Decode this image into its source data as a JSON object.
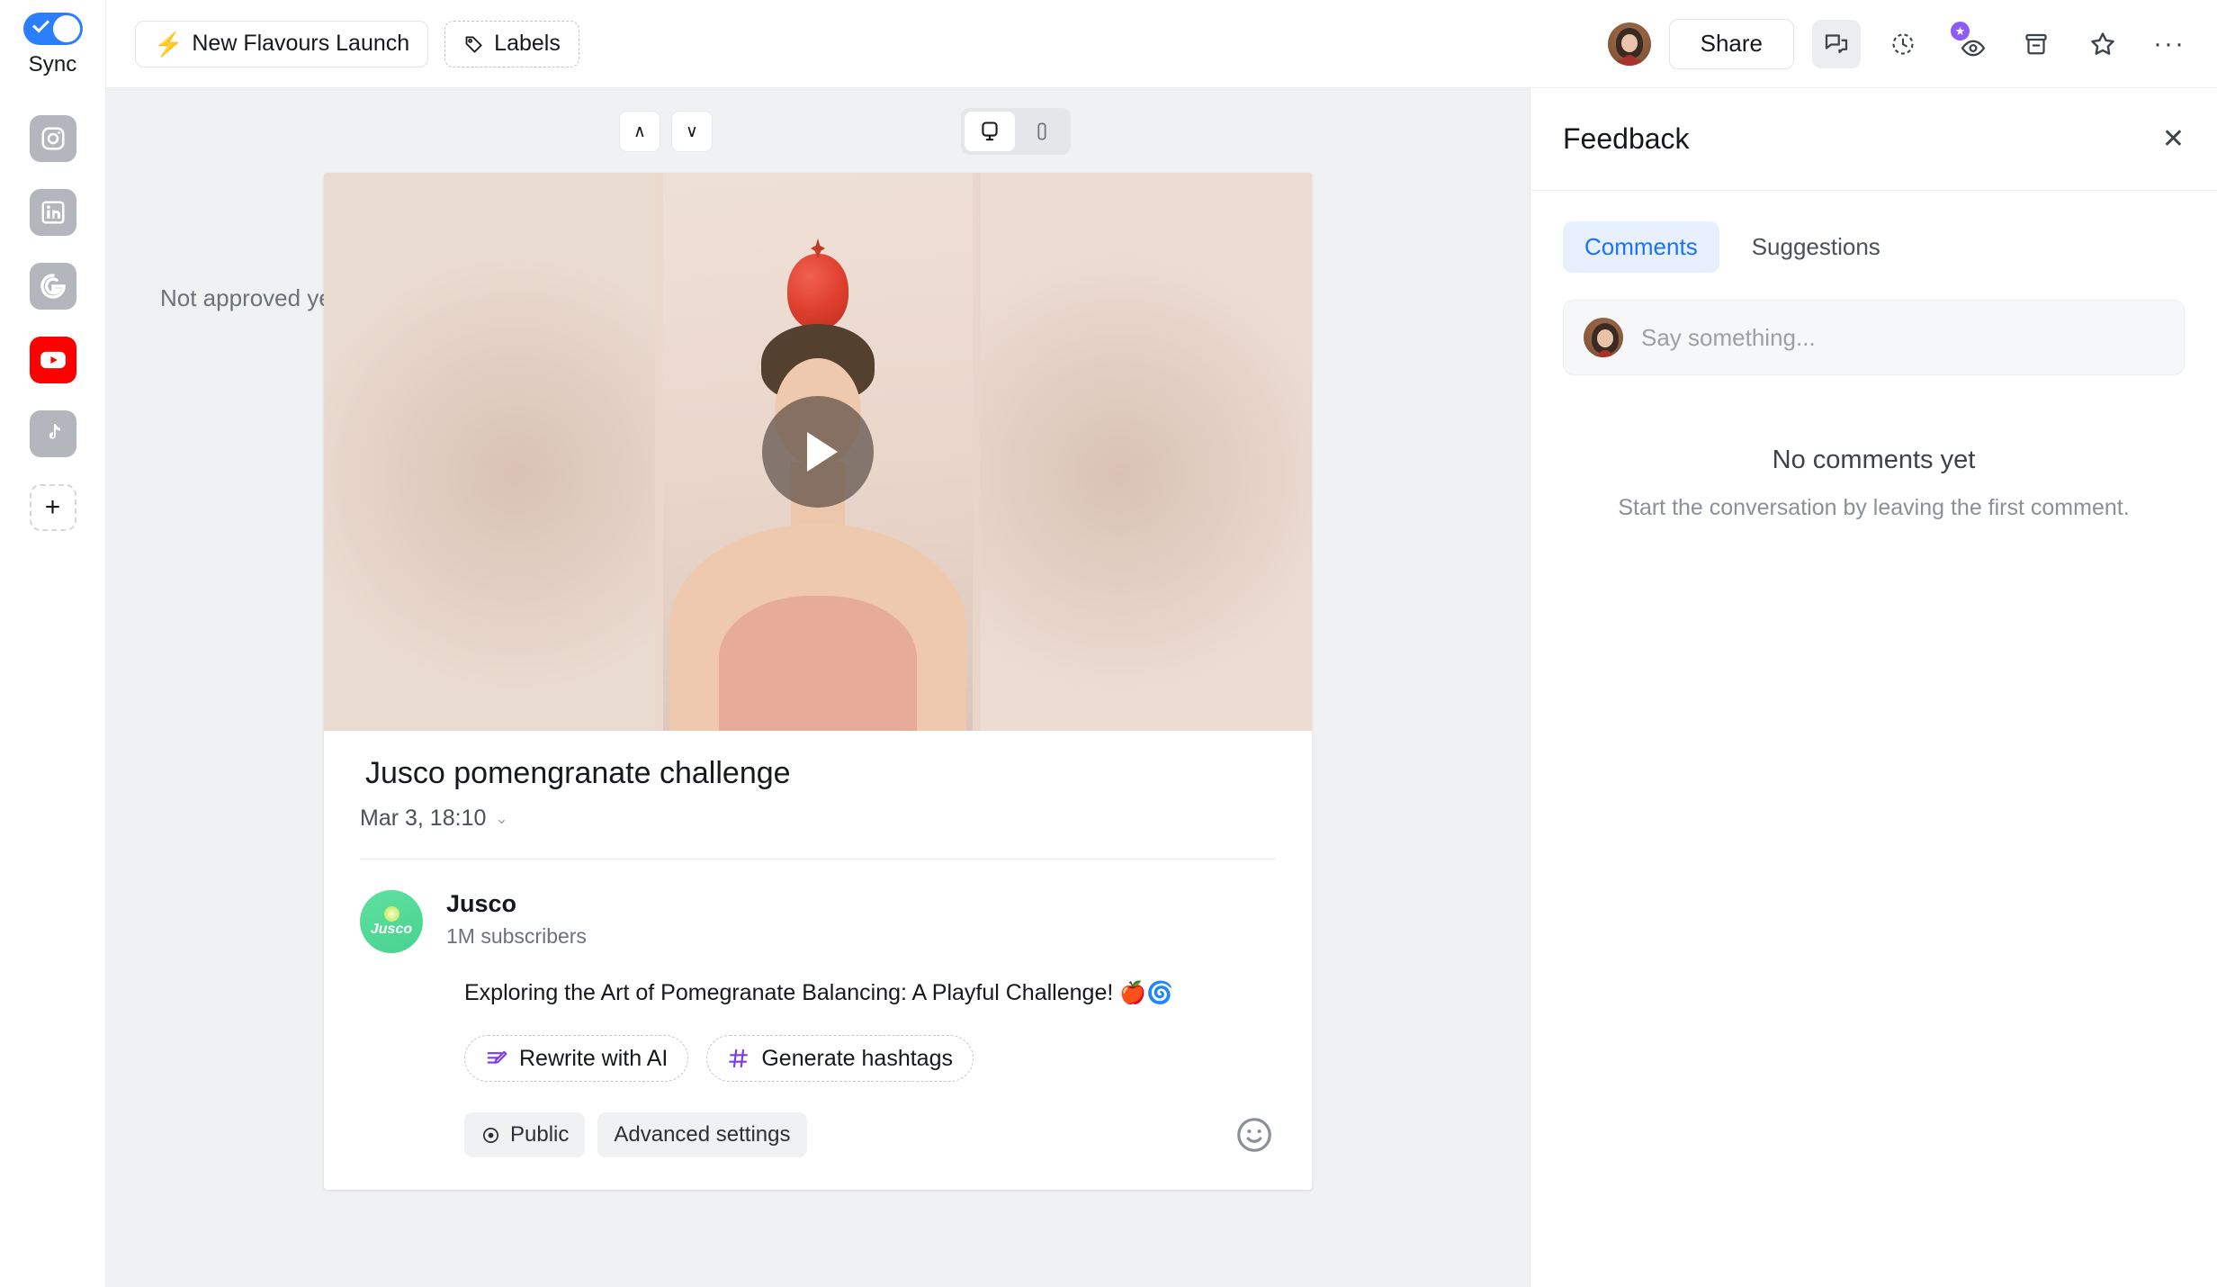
{
  "rail": {
    "sync": {
      "label": "Sync",
      "enabled": true
    },
    "channels": [
      {
        "name": "instagram",
        "icon": "instagram-icon",
        "active": false
      },
      {
        "name": "linkedin",
        "icon": "linkedin-icon",
        "active": false
      },
      {
        "name": "google",
        "icon": "google-icon",
        "active": false
      },
      {
        "name": "youtube",
        "icon": "youtube-icon",
        "active": true
      },
      {
        "name": "tiktok",
        "icon": "tiktok-icon",
        "active": false
      }
    ],
    "add_label": "+"
  },
  "topbar": {
    "campaign": {
      "label": "New Flavours Launch",
      "icon": "lightning-icon"
    },
    "labels": {
      "label": "Labels",
      "icon": "tag-icon"
    },
    "share_label": "Share",
    "icons": [
      {
        "name": "comments-icon",
        "active": true
      },
      {
        "name": "history-clock-icon",
        "active": false
      },
      {
        "name": "preview-eye-icon",
        "active": false,
        "badge": "star"
      },
      {
        "name": "archive-icon",
        "active": false
      },
      {
        "name": "star-icon",
        "active": false
      },
      {
        "name": "more-options-icon",
        "active": false
      }
    ]
  },
  "canvas": {
    "approval_status": "Not approved yet",
    "nav": {
      "up": "∧",
      "down": "∨"
    },
    "device_toggle": {
      "desktop_active": true,
      "mobile_active": false
    }
  },
  "post": {
    "title": "Jusco pomengranate challenge",
    "date": "Mar 3, 18:10",
    "channel": {
      "name": "Jusco",
      "subscribers": "1M subscribers",
      "avatar_text": "Jusco"
    },
    "description": "Exploring the Art of Pomegranate Balancing: A Playful Challenge!",
    "description_emojis": "🍎🌀",
    "ai_buttons": [
      {
        "label": "Rewrite with AI",
        "icon": "rewrite-ai-icon"
      },
      {
        "label": "Generate hashtags",
        "icon": "hashtag-icon"
      }
    ],
    "meta_buttons": [
      {
        "label": "Public",
        "icon": "eye-icon"
      },
      {
        "label": "Advanced settings",
        "icon": null
      }
    ]
  },
  "feedback": {
    "title": "Feedback",
    "tabs": [
      {
        "label": "Comments",
        "active": true
      },
      {
        "label": "Suggestions",
        "active": false
      }
    ],
    "composer_placeholder": "Say something...",
    "empty_title": "No comments yet",
    "empty_subtitle": "Start the conversation by leaving the first comment."
  },
  "colors": {
    "accent_blue": "#2b7fff",
    "youtube_red": "#ff0000",
    "ai_purple": "#7c3aed",
    "bolt_teal": "#16c7b3",
    "badge_purple": "#8b5cf6"
  }
}
